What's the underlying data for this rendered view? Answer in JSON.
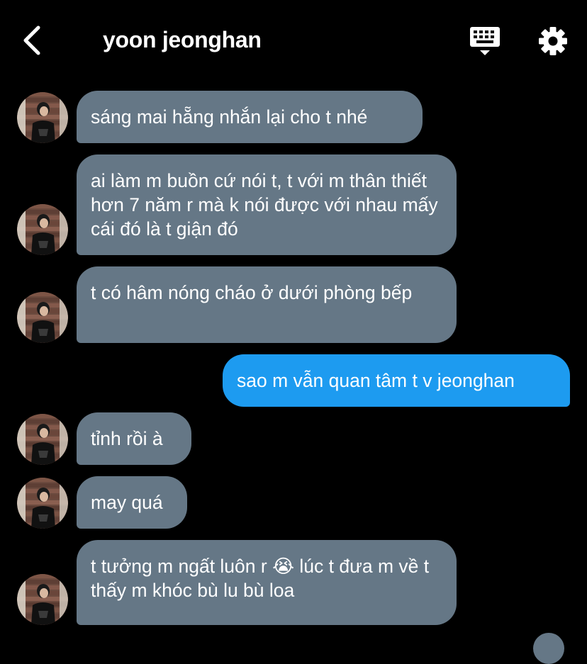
{
  "header": {
    "title": "yoon jeonghan",
    "back_icon": "chevron-left-icon",
    "keyboard_icon": "keyboard-icon",
    "settings_icon": "gear-icon"
  },
  "colors": {
    "background": "#000000",
    "incoming_bubble": "#657786",
    "outgoing_bubble": "#1d9bf0",
    "text": "#ffffff"
  },
  "messages": [
    {
      "sender": "them",
      "text": "sáng mai hẵng nhắn lại cho t nhé"
    },
    {
      "sender": "them",
      "text": "ai làm m buồn cứ nói t, t với m thân thiết hơn 7 năm r mà k nói được với nhau mấy cái đó là t giận đó"
    },
    {
      "sender": "them",
      "text": "t có hâm nóng cháo ở dưới phòng bếp"
    },
    {
      "sender": "me",
      "text": "sao m vẫn quan tâm t v jeonghan"
    },
    {
      "sender": "them",
      "text": "tỉnh rồi à"
    },
    {
      "sender": "them",
      "text": "may quá"
    },
    {
      "sender": "them",
      "text": "t tưởng m ngất luôn r 😭  lúc t đưa m về t thấy m khóc bù lu bù loa"
    }
  ]
}
